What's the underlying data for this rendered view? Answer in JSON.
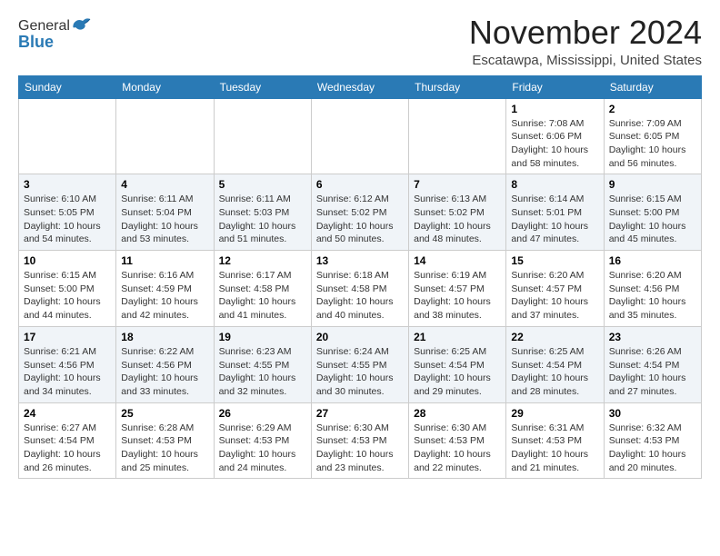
{
  "header": {
    "logo_general": "General",
    "logo_blue": "Blue",
    "month_title": "November 2024",
    "location": "Escatawpa, Mississippi, United States"
  },
  "weekdays": [
    "Sunday",
    "Monday",
    "Tuesday",
    "Wednesday",
    "Thursday",
    "Friday",
    "Saturday"
  ],
  "rows": [
    [
      {
        "day": "",
        "sunrise": "",
        "sunset": "",
        "daylight": ""
      },
      {
        "day": "",
        "sunrise": "",
        "sunset": "",
        "daylight": ""
      },
      {
        "day": "",
        "sunrise": "",
        "sunset": "",
        "daylight": ""
      },
      {
        "day": "",
        "sunrise": "",
        "sunset": "",
        "daylight": ""
      },
      {
        "day": "",
        "sunrise": "",
        "sunset": "",
        "daylight": ""
      },
      {
        "day": "1",
        "sunrise": "Sunrise: 7:08 AM",
        "sunset": "Sunset: 6:06 PM",
        "daylight": "Daylight: 10 hours and 58 minutes."
      },
      {
        "day": "2",
        "sunrise": "Sunrise: 7:09 AM",
        "sunset": "Sunset: 6:05 PM",
        "daylight": "Daylight: 10 hours and 56 minutes."
      }
    ],
    [
      {
        "day": "3",
        "sunrise": "Sunrise: 6:10 AM",
        "sunset": "Sunset: 5:05 PM",
        "daylight": "Daylight: 10 hours and 54 minutes."
      },
      {
        "day": "4",
        "sunrise": "Sunrise: 6:11 AM",
        "sunset": "Sunset: 5:04 PM",
        "daylight": "Daylight: 10 hours and 53 minutes."
      },
      {
        "day": "5",
        "sunrise": "Sunrise: 6:11 AM",
        "sunset": "Sunset: 5:03 PM",
        "daylight": "Daylight: 10 hours and 51 minutes."
      },
      {
        "day": "6",
        "sunrise": "Sunrise: 6:12 AM",
        "sunset": "Sunset: 5:02 PM",
        "daylight": "Daylight: 10 hours and 50 minutes."
      },
      {
        "day": "7",
        "sunrise": "Sunrise: 6:13 AM",
        "sunset": "Sunset: 5:02 PM",
        "daylight": "Daylight: 10 hours and 48 minutes."
      },
      {
        "day": "8",
        "sunrise": "Sunrise: 6:14 AM",
        "sunset": "Sunset: 5:01 PM",
        "daylight": "Daylight: 10 hours and 47 minutes."
      },
      {
        "day": "9",
        "sunrise": "Sunrise: 6:15 AM",
        "sunset": "Sunset: 5:00 PM",
        "daylight": "Daylight: 10 hours and 45 minutes."
      }
    ],
    [
      {
        "day": "10",
        "sunrise": "Sunrise: 6:15 AM",
        "sunset": "Sunset: 5:00 PM",
        "daylight": "Daylight: 10 hours and 44 minutes."
      },
      {
        "day": "11",
        "sunrise": "Sunrise: 6:16 AM",
        "sunset": "Sunset: 4:59 PM",
        "daylight": "Daylight: 10 hours and 42 minutes."
      },
      {
        "day": "12",
        "sunrise": "Sunrise: 6:17 AM",
        "sunset": "Sunset: 4:58 PM",
        "daylight": "Daylight: 10 hours and 41 minutes."
      },
      {
        "day": "13",
        "sunrise": "Sunrise: 6:18 AM",
        "sunset": "Sunset: 4:58 PM",
        "daylight": "Daylight: 10 hours and 40 minutes."
      },
      {
        "day": "14",
        "sunrise": "Sunrise: 6:19 AM",
        "sunset": "Sunset: 4:57 PM",
        "daylight": "Daylight: 10 hours and 38 minutes."
      },
      {
        "day": "15",
        "sunrise": "Sunrise: 6:20 AM",
        "sunset": "Sunset: 4:57 PM",
        "daylight": "Daylight: 10 hours and 37 minutes."
      },
      {
        "day": "16",
        "sunrise": "Sunrise: 6:20 AM",
        "sunset": "Sunset: 4:56 PM",
        "daylight": "Daylight: 10 hours and 35 minutes."
      }
    ],
    [
      {
        "day": "17",
        "sunrise": "Sunrise: 6:21 AM",
        "sunset": "Sunset: 4:56 PM",
        "daylight": "Daylight: 10 hours and 34 minutes."
      },
      {
        "day": "18",
        "sunrise": "Sunrise: 6:22 AM",
        "sunset": "Sunset: 4:56 PM",
        "daylight": "Daylight: 10 hours and 33 minutes."
      },
      {
        "day": "19",
        "sunrise": "Sunrise: 6:23 AM",
        "sunset": "Sunset: 4:55 PM",
        "daylight": "Daylight: 10 hours and 32 minutes."
      },
      {
        "day": "20",
        "sunrise": "Sunrise: 6:24 AM",
        "sunset": "Sunset: 4:55 PM",
        "daylight": "Daylight: 10 hours and 30 minutes."
      },
      {
        "day": "21",
        "sunrise": "Sunrise: 6:25 AM",
        "sunset": "Sunset: 4:54 PM",
        "daylight": "Daylight: 10 hours and 29 minutes."
      },
      {
        "day": "22",
        "sunrise": "Sunrise: 6:25 AM",
        "sunset": "Sunset: 4:54 PM",
        "daylight": "Daylight: 10 hours and 28 minutes."
      },
      {
        "day": "23",
        "sunrise": "Sunrise: 6:26 AM",
        "sunset": "Sunset: 4:54 PM",
        "daylight": "Daylight: 10 hours and 27 minutes."
      }
    ],
    [
      {
        "day": "24",
        "sunrise": "Sunrise: 6:27 AM",
        "sunset": "Sunset: 4:54 PM",
        "daylight": "Daylight: 10 hours and 26 minutes."
      },
      {
        "day": "25",
        "sunrise": "Sunrise: 6:28 AM",
        "sunset": "Sunset: 4:53 PM",
        "daylight": "Daylight: 10 hours and 25 minutes."
      },
      {
        "day": "26",
        "sunrise": "Sunrise: 6:29 AM",
        "sunset": "Sunset: 4:53 PM",
        "daylight": "Daylight: 10 hours and 24 minutes."
      },
      {
        "day": "27",
        "sunrise": "Sunrise: 6:30 AM",
        "sunset": "Sunset: 4:53 PM",
        "daylight": "Daylight: 10 hours and 23 minutes."
      },
      {
        "day": "28",
        "sunrise": "Sunrise: 6:30 AM",
        "sunset": "Sunset: 4:53 PM",
        "daylight": "Daylight: 10 hours and 22 minutes."
      },
      {
        "day": "29",
        "sunrise": "Sunrise: 6:31 AM",
        "sunset": "Sunset: 4:53 PM",
        "daylight": "Daylight: 10 hours and 21 minutes."
      },
      {
        "day": "30",
        "sunrise": "Sunrise: 6:32 AM",
        "sunset": "Sunset: 4:53 PM",
        "daylight": "Daylight: 10 hours and 20 minutes."
      }
    ]
  ],
  "row_styles": [
    "row-first",
    "row-even",
    "row-odd",
    "row-even",
    "row-odd"
  ]
}
